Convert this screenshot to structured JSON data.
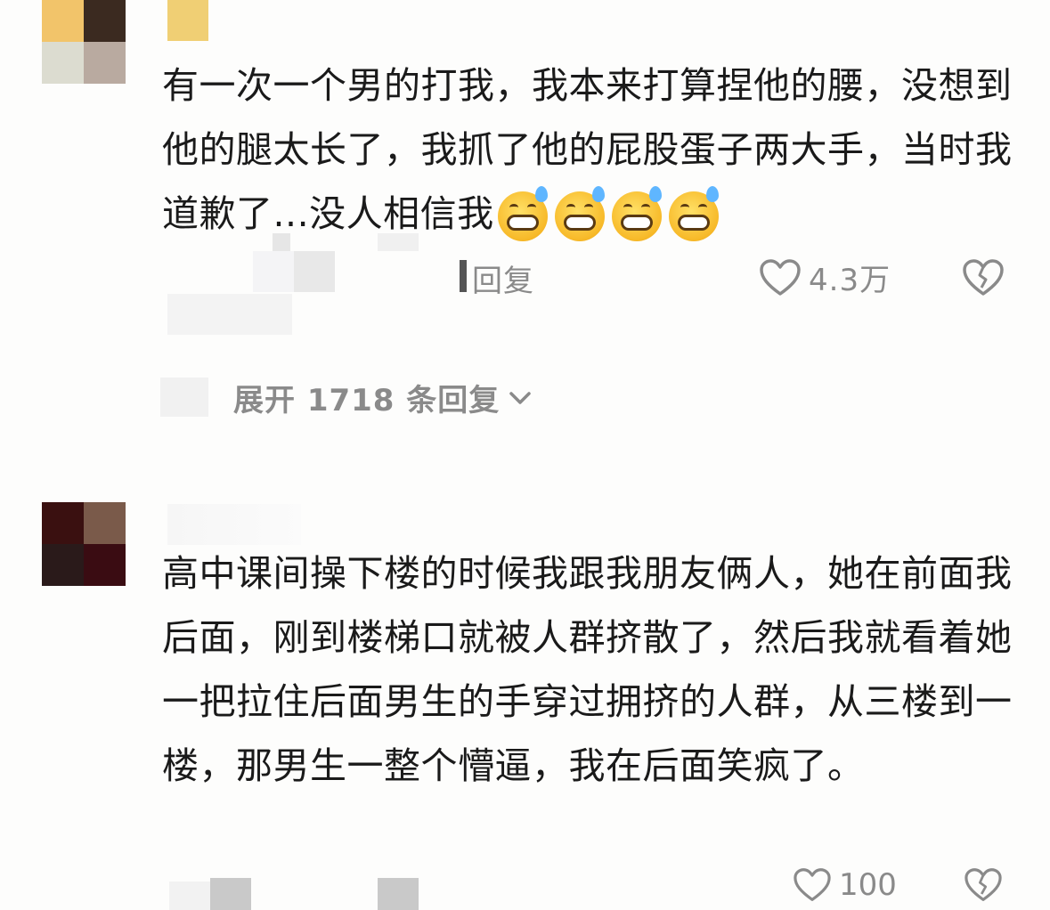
{
  "comments": [
    {
      "avatar_colors": [
        "#f2c46a",
        "#3b2a20",
        "#dcdcd0",
        "#b9aaa0"
      ],
      "text": "有一次一个男的打我，我本来打算捏他的腰，没想到他的腿太长了，我抓了他的屁股蛋子两大手，当时我道歉了...没人相信我",
      "emoji_count": 4,
      "reply_label": "回复",
      "like_count": "4.3万",
      "like_icon": "heart-outline-icon",
      "dislike_icon": "broken-heart-icon",
      "expand_label": "展开 1718 条回复",
      "expand_icon": "chevron-down-icon"
    },
    {
      "avatar_colors": [
        "#3a1010",
        "#7a5a4a",
        "#2a1a1a",
        "#3a0c12"
      ],
      "text": "高中课间操下楼的时候我跟我朋友俩人，她在前面我后面，刚到楼梯口就被人群挤散了，然后我就看着她一把拉住后面男生的手穿过拥挤的人群，从三楼到一楼，那男生一整个懵逼，我在后面笑疯了。",
      "like_count": "100",
      "like_icon": "heart-outline-icon",
      "dislike_icon": "broken-heart-icon"
    }
  ],
  "colors": {
    "text": "#1a1a1a",
    "meta": "#8a8a8a",
    "background": "#fdfdfc"
  }
}
